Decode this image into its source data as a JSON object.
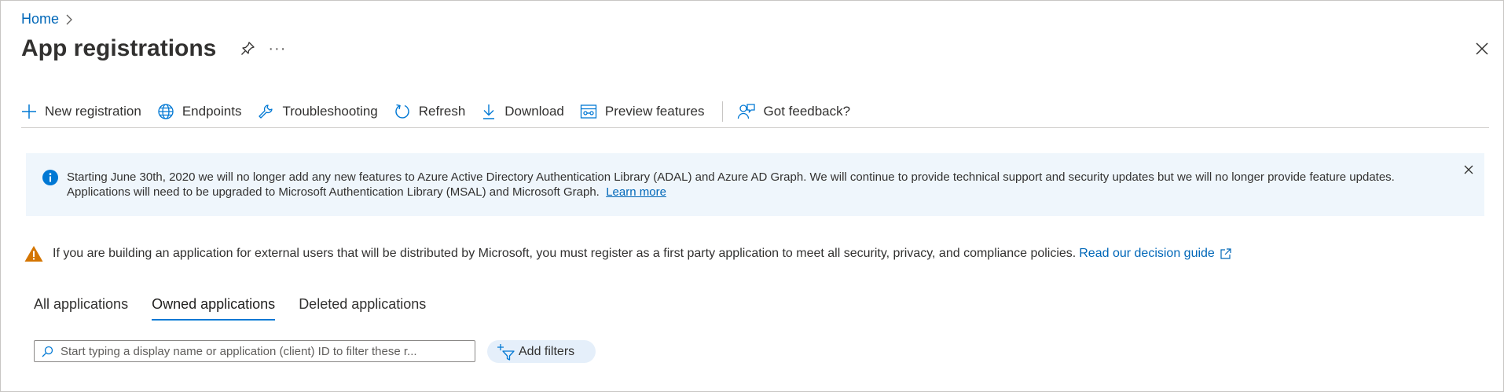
{
  "breadcrumb": {
    "home": "Home"
  },
  "page": {
    "title": "App registrations",
    "more": "···"
  },
  "toolbar": {
    "new_registration": "New registration",
    "endpoints": "Endpoints",
    "troubleshooting": "Troubleshooting",
    "refresh": "Refresh",
    "download": "Download",
    "preview_features": "Preview features",
    "got_feedback": "Got feedback?"
  },
  "info_banner": {
    "line1": "Starting June 30th, 2020 we will no longer add any new features to Azure Active Directory Authentication Library (ADAL) and Azure AD Graph. We will continue to provide technical support and security updates but we will no longer provide feature updates.",
    "line2": "Applications will need to be upgraded to Microsoft Authentication Library (MSAL) and Microsoft Graph.",
    "link": "Learn more"
  },
  "warning": {
    "text": "If you are building an application for external users that will be distributed by Microsoft, you must register as a first party application to meet all security, privacy, and compliance policies.",
    "link": "Read our decision guide"
  },
  "tabs": [
    {
      "label": "All applications"
    },
    {
      "label": "Owned applications",
      "active": true
    },
    {
      "label": "Deleted applications"
    }
  ],
  "search": {
    "placeholder": "Start typing a display name or application (client) ID to filter these r...",
    "value": ""
  },
  "filters": {
    "add_label": "Add filters"
  },
  "colors": {
    "accent": "#0078d4",
    "link": "#0067b8",
    "banner_bg": "#eff6fc",
    "warning": "#d47500"
  }
}
